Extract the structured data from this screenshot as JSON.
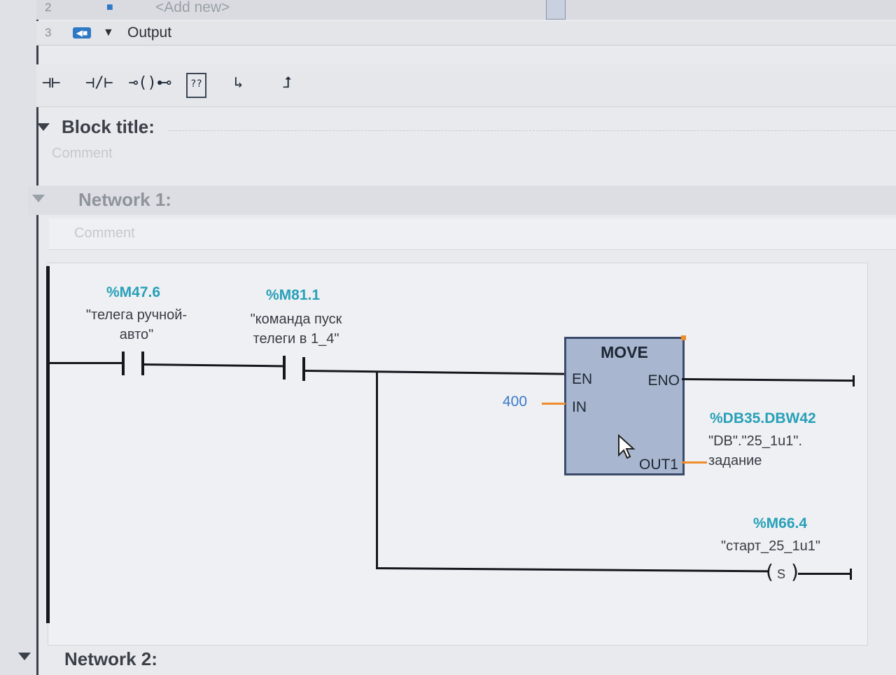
{
  "table_rows": {
    "row2": {
      "num": "2",
      "text": "<Add new>"
    },
    "row3": {
      "num": "3",
      "icon": "output-interface-icon",
      "label": "Output"
    }
  },
  "toolbar": {
    "items": [
      {
        "name": "normally-open-contact-button",
        "glyph": "⊣⊢"
      },
      {
        "name": "normally-closed-contact-button",
        "glyph": "⊣/⊢"
      },
      {
        "name": "coil-button",
        "glyph": "⊸()⊷"
      },
      {
        "name": "empty-box-button",
        "glyph": "??"
      },
      {
        "name": "open-branch-button",
        "glyph": "↳"
      },
      {
        "name": "close-branch-button",
        "glyph": "⮥"
      }
    ]
  },
  "block": {
    "title_label": "Block title:",
    "comment": "Comment"
  },
  "network1": {
    "title": "Network 1:",
    "comment": "Comment",
    "contact1": {
      "address": "%M47.6",
      "symbol_line1": "\"телега ручной-",
      "symbol_line2": "авто\""
    },
    "contact2": {
      "address": "%M81.1",
      "symbol_line1": "\"команда пуск",
      "symbol_line2": "телеги в 1_4\""
    },
    "move": {
      "title": "MOVE",
      "pin_en": "EN",
      "pin_eno": "ENO",
      "pin_in": "IN",
      "pin_out": "OUT1",
      "in_value": "400",
      "out_address": "%DB35.DBW42",
      "out_symbol_line1": "\"DB\".\"25_1u1\".",
      "out_symbol_line2": "задание"
    },
    "coil": {
      "address": "%M66.4",
      "symbol": "\"старт_25_1u1\"",
      "type": "S"
    }
  },
  "network2": {
    "title": "Network 2:"
  }
}
